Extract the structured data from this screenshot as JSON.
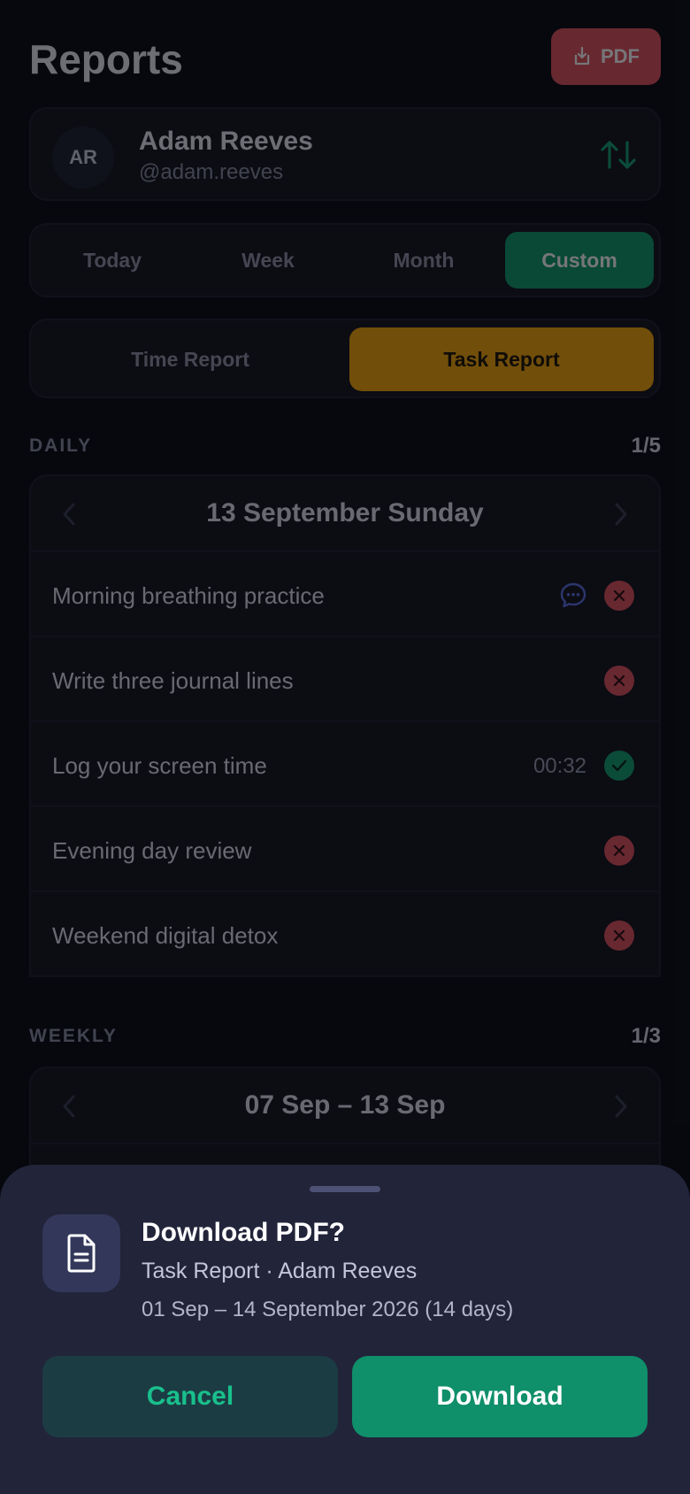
{
  "header": {
    "title": "Reports",
    "pdf_label": "PDF"
  },
  "user": {
    "initials": "AR",
    "name": "Adam Reeves",
    "handle": "@adam.reeves"
  },
  "range_tabs": [
    "Today",
    "Week",
    "Month",
    "Custom"
  ],
  "range_active": "Custom",
  "report_types": [
    "Time Report",
    "Task Report"
  ],
  "report_active": "Task Report",
  "daily": {
    "label": "DAILY",
    "count": "1/5",
    "date": "13 September Sunday",
    "rows": [
      {
        "title": "Morning breathing practice",
        "status": "missed",
        "comment": true
      },
      {
        "title": "Write three journal lines",
        "status": "missed"
      },
      {
        "title": "Log your screen time",
        "time": "00:32",
        "status": "done"
      },
      {
        "title": "Evening day review",
        "status": "missed"
      },
      {
        "title": "Weekend digital detox",
        "status": "missed"
      }
    ]
  },
  "weekly": {
    "label": "WEEKLY",
    "count": "1/3",
    "range": "07 Sep – 13 Sep"
  },
  "sheet": {
    "title": "Download PDF?",
    "subtitle": "Task Report · Adam Reeves",
    "range": "01 Sep – 14 September 2026 (14 days)",
    "cancel_label": "Cancel",
    "download_label": "Download"
  },
  "colors": {
    "accent_green": "#0f9b6e",
    "accent_orange": "#f4a60c",
    "danger": "#e0535f",
    "background": "#0b0c14"
  }
}
